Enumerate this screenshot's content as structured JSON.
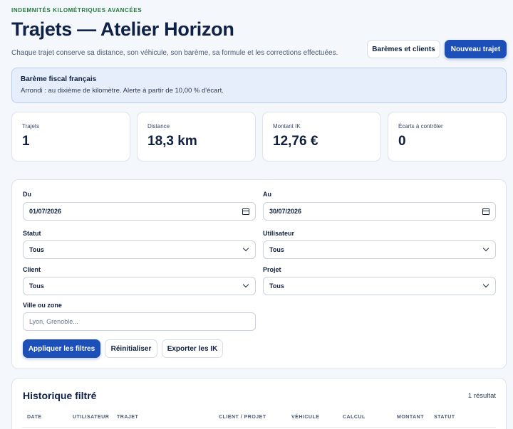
{
  "header": {
    "eyebrow": "INDEMNITÉS KILOMÉTRIQUES AVANCÉES",
    "title": "Trajets — Atelier Horizon",
    "subtitle": "Chaque trajet conserve sa distance, son véhicule, son barème, sa formule et les corrections effectuées.",
    "btn_baremes": "Barèmes et clients",
    "btn_new": "Nouveau trajet"
  },
  "notice": {
    "title": "Barème fiscal français",
    "text": "Arrondi : au dixième de kilomètre. Alerte à partir de 10,00 % d'écart."
  },
  "stats": [
    {
      "label": "Trajets",
      "value": "1"
    },
    {
      "label": "Distance",
      "value": "18,3 km"
    },
    {
      "label": "Montant IK",
      "value": "12,76 €"
    },
    {
      "label": "Écarts à contrôler",
      "value": "0"
    }
  ],
  "filters": {
    "from_label": "Du",
    "from_value": "01/07/2026",
    "to_label": "Au",
    "to_value": "30/07/2026",
    "status_label": "Statut",
    "status_value": "Tous",
    "user_label": "Utilisateur",
    "user_value": "Tous",
    "client_label": "Client",
    "client_value": "Tous",
    "project_label": "Projet",
    "project_value": "Tous",
    "city_label": "Ville ou zone",
    "city_placeholder": "Lyon, Grenoble...",
    "apply": "Appliquer les filtres",
    "reset": "Réinitialiser",
    "export": "Exporter les IK"
  },
  "history": {
    "title": "Historique filtré",
    "count": "1 résultat",
    "columns": [
      "DATE",
      "UTILISATEUR",
      "TRAJET",
      "CLIENT / PROJET",
      "VÉHICULE",
      "CALCUL",
      "MONTANT",
      "STATUT"
    ]
  }
}
